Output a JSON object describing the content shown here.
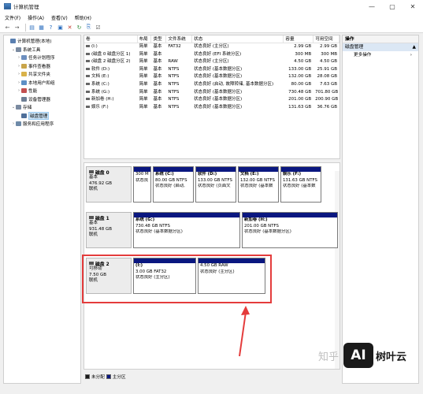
{
  "window": {
    "title": "计算机管理",
    "controls": [
      "—",
      "▢",
      "✕"
    ]
  },
  "menu": [
    "文件(F)",
    "操作(A)",
    "查看(V)",
    "帮助(H)"
  ],
  "tree": [
    {
      "label": "计算机管理(本地)",
      "level": 0,
      "exp": "",
      "color": "#5a7fb0"
    },
    {
      "label": "系统工具",
      "level": 1,
      "exp": "⌄",
      "color": "#7a8aa0"
    },
    {
      "label": "任务计划程序",
      "level": 2,
      "exp": "›",
      "color": "#6d8fbf"
    },
    {
      "label": "事件查看器",
      "level": 2,
      "exp": "›",
      "color": "#c9a54a"
    },
    {
      "label": "共享文件夹",
      "level": 2,
      "exp": "›",
      "color": "#d9b24a"
    },
    {
      "label": "本地用户和组",
      "level": 2,
      "exp": "›",
      "color": "#5d8fc5"
    },
    {
      "label": "性能",
      "level": 2,
      "exp": "›",
      "color": "#c35050"
    },
    {
      "label": "设备管理器",
      "level": 2,
      "exp": "",
      "color": "#6e7f95"
    },
    {
      "label": "存储",
      "level": 1,
      "exp": "⌄",
      "color": "#7a8aa0"
    },
    {
      "label": "磁盘管理",
      "level": 2,
      "exp": "",
      "color": "#4e6f9a",
      "selected": true
    },
    {
      "label": "服务和应用程序",
      "level": 1,
      "exp": "›",
      "color": "#6e8aa8"
    }
  ],
  "columns": [
    "卷",
    "布局",
    "类型",
    "文件系统",
    "状态",
    "容量",
    "可用空间"
  ],
  "volumes": [
    {
      "vol": "(I:)",
      "layout": "简单",
      "type": "基本",
      "fs": "FAT32",
      "status": "状态良好 (主分区)",
      "cap": "2.99 GB",
      "free": "2.99 GB"
    },
    {
      "vol": "(磁盘 0 磁盘分区 1)",
      "layout": "简单",
      "type": "基本",
      "fs": "",
      "status": "状态良好 (EFI 系统分区)",
      "cap": "300 MB",
      "free": "300 MB"
    },
    {
      "vol": "(磁盘 2 磁盘分区 2)",
      "layout": "简单",
      "type": "基本",
      "fs": "RAW",
      "status": "状态良好 (主分区)",
      "cap": "4.50 GB",
      "free": "4.50 GB"
    },
    {
      "vol": "软件 (D:)",
      "layout": "简单",
      "type": "基本",
      "fs": "NTFS",
      "status": "状态良好 (基本数据分区)",
      "cap": "133.00 GB",
      "free": "25.91 GB"
    },
    {
      "vol": "文档 (E:)",
      "layout": "简单",
      "type": "基本",
      "fs": "NTFS",
      "status": "状态良好 (基本数据分区)",
      "cap": "132.00 GB",
      "free": "28.08 GB"
    },
    {
      "vol": "系统 (C:)",
      "layout": "简单",
      "type": "基本",
      "fs": "NTFS",
      "status": "状态良好 (启动, 故障转储, 基本数据分区)",
      "cap": "80.00 GB",
      "free": "7.63 GB"
    },
    {
      "vol": "系统 (G:)",
      "layout": "简单",
      "type": "基本",
      "fs": "NTFS",
      "status": "状态良好 (基本数据分区)",
      "cap": "730.48 GB",
      "free": "701.80 GB"
    },
    {
      "vol": "新加卷 (H:)",
      "layout": "简单",
      "type": "基本",
      "fs": "NTFS",
      "status": "状态良好 (基本数据分区)",
      "cap": "201.00 GB",
      "free": "200.90 GB"
    },
    {
      "vol": "娱乐 (F:)",
      "layout": "简单",
      "type": "基本",
      "fs": "NTFS",
      "status": "状态良好 (基本数据分区)",
      "cap": "131.63 GB",
      "free": "36.76 GB"
    }
  ],
  "disks": [
    {
      "name": "磁盘 0",
      "kind": "基本",
      "size": "476.92 GB",
      "state": "联机",
      "parts": [
        {
          "w": 23,
          "l1": "",
          "l2": "300 M",
          "l3": "状态良"
        },
        {
          "w": 52,
          "l1": "系统 (C:)",
          "l2": "80.00 GB NTFS",
          "l3": "状态良好 (启动,"
        },
        {
          "w": 52,
          "l1": "软件 (D:)",
          "l2": "133.00 GB NTFS",
          "l3": "状态良好 (页面文"
        },
        {
          "w": 52,
          "l1": "文档 (E:)",
          "l2": "132.00 GB NTFS",
          "l3": "状态良好 (基本数"
        },
        {
          "w": 52,
          "l1": "娱乐 (F:)",
          "l2": "131.63 GB NTFS",
          "l3": "状态良好 (基本数"
        }
      ]
    },
    {
      "name": "磁盘 1",
      "kind": "基本",
      "size": "931.48 GB",
      "state": "联机",
      "parts": [
        {
          "w": 136,
          "l1": "系统 (G:)",
          "l2": "730.48 GB NTFS",
          "l3": "状态良好 (基本数据分区)"
        },
        {
          "w": 122,
          "l1": "新加卷 (H:)",
          "l2": "201.00 GB NTFS",
          "l3": "状态良好 (基本数据分区)"
        }
      ]
    },
    {
      "name": "磁盘 2",
      "kind": "可移动",
      "size": "7.50 GB",
      "state": "联机",
      "parts": [
        {
          "w": 80,
          "l1": "(I:)",
          "l2": "3.00 GB FAT32",
          "l3": "状态良好 (主分区)"
        },
        {
          "w": 86,
          "l1": "",
          "l2": "4.50 GB RAW",
          "l3": "状态良好 (主分区)"
        }
      ]
    }
  ],
  "legend": [
    {
      "label": "未分配",
      "color": "#1a1a1a"
    },
    {
      "label": "主分区",
      "color": "#0a1780"
    }
  ],
  "actions": {
    "header": "操作",
    "selected": "磁盘管理",
    "more": "更多操作"
  },
  "watermark": {
    "left": "知乎",
    "logo": "AI",
    "brand": "树叶云"
  }
}
